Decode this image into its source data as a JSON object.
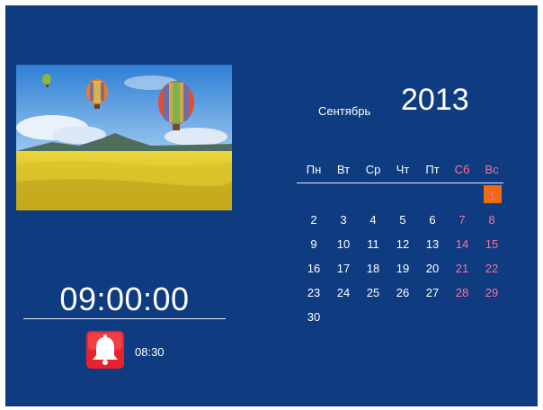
{
  "clock": {
    "time": "09:00:00",
    "alarm_time": "08:30"
  },
  "calendar": {
    "month": "Сентябрь",
    "year": "2013",
    "weekdays": [
      "Пн",
      "Вт",
      "Ср",
      "Чт",
      "Пт",
      "Сб",
      "Вс"
    ],
    "weeks": [
      [
        "",
        "",
        "",
        "",
        "",
        "",
        "1"
      ],
      [
        "2",
        "3",
        "4",
        "5",
        "6",
        "7",
        "8"
      ],
      [
        "9",
        "10",
        "11",
        "12",
        "13",
        "14",
        "15"
      ],
      [
        "16",
        "17",
        "18",
        "19",
        "20",
        "21",
        "22"
      ],
      [
        "23",
        "24",
        "25",
        "26",
        "27",
        "28",
        "29"
      ],
      [
        "30",
        "",
        "",
        "",
        "",
        "",
        ""
      ]
    ],
    "today": "1"
  },
  "photo": {
    "description": "hot-air-balloons-over-flower-field"
  },
  "colors": {
    "background": "#0f3c80",
    "weekend": "#ff6f9a",
    "today_highlight": "#f06a10",
    "alarm": "#e8232b"
  },
  "icons": {
    "alarm": "bell-icon"
  }
}
